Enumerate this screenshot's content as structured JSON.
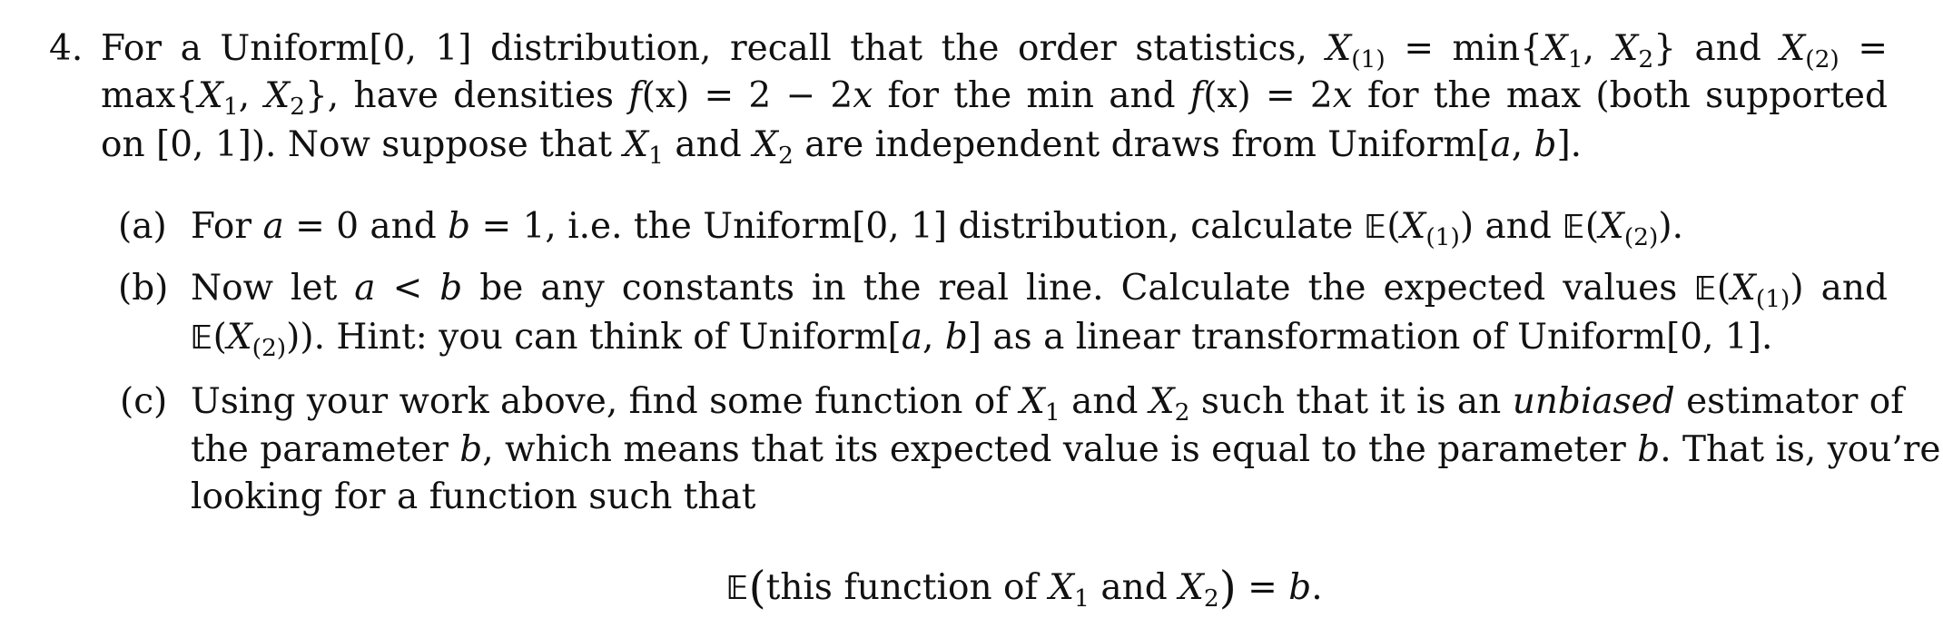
{
  "problem": {
    "number": "4.",
    "intro": {
      "line1": {
        "t1": "For a Uniform[0, 1] distribution, recall that the order statistics, ",
        "X": "X",
        "sub1": "(1)",
        "eq": " = min{",
        "X1": "X",
        "s1": "1",
        "comma": ", ",
        "X2": "X",
        "s2": "2",
        "close": "} and ",
        "Xb": "X",
        "sub2": "(2)",
        "eq2": " ="
      },
      "line2": {
        "t1": "max{",
        "X1": "X",
        "s1": "1",
        "comma": ", ",
        "X2": "X",
        "s2": "2",
        "t2": "}, have densities ",
        "f": "f",
        "x": "(x)",
        "t3": " = 2 − 2",
        "xv": "x",
        "t4": " for the min and ",
        "f2": "f",
        "x2": "(x)",
        "t5": " = 2",
        "xv2": "x",
        "t6": " for the max (both supported"
      },
      "line3": {
        "t1": "on [0, 1]). Now suppose that ",
        "X1": "X",
        "s1": "1",
        "t2": " and ",
        "X2": "X",
        "s2": "2",
        "t3": " are independent draws from Uniform[",
        "a": "a",
        "c": ", ",
        "b": "b",
        "t4": "]."
      }
    },
    "parts": [
      {
        "label": "(a)",
        "line1": {
          "t1": "For ",
          "a": "a",
          "t2": " = 0 and ",
          "b": "b",
          "t3": " = 1, i.e. the Uniform[0, 1] distribution, calculate ",
          "E": "𝔼",
          "X": "X",
          "sub1": "(1)",
          "t4": ") and ",
          "E2": "𝔼",
          "Xb": "X",
          "sub2": "(2)",
          "t5": ")."
        }
      },
      {
        "label": "(b)",
        "line1": {
          "t1": "Now let ",
          "a": "a",
          "lt": " < ",
          "b": "b",
          "t2": " be any constants in the real line.  Calculate the expected values ",
          "E": "𝔼",
          "X": "X",
          "sub1": "(1)",
          "t3": ") and"
        },
        "line2": {
          "E": "𝔼",
          "X": "X",
          "sub2": "(2)",
          "t1": ")). Hint: you can think of Uniform[",
          "a": "a",
          "c": ", ",
          "b": "b",
          "t2": "] as a linear transformation of Uniform[0, 1]."
        }
      },
      {
        "label": "(c)",
        "line1": {
          "t1": "Using your work above, find some function of ",
          "X1": "X",
          "s1": "1",
          "t2": " and ",
          "X2": "X",
          "s2": "2",
          "t3": " such that it is an ",
          "em": "unbiased",
          "t4": " estimator of"
        },
        "line2": {
          "t1": "the parameter ",
          "b": "b",
          "t2": ", which means that its expected value is equal to the parameter ",
          "b2": "b",
          "t3": ". That is, you’re"
        },
        "line3": {
          "t1": "looking for a function such that"
        }
      }
    ],
    "display_equation": {
      "E": "𝔼",
      "open": "(",
      "t1": "this function of ",
      "X1": "X",
      "s1": "1",
      "t2": " and ",
      "X2": "X",
      "s2": "2",
      "close": ")",
      "eq": " = ",
      "b": "b",
      "end": "."
    }
  }
}
